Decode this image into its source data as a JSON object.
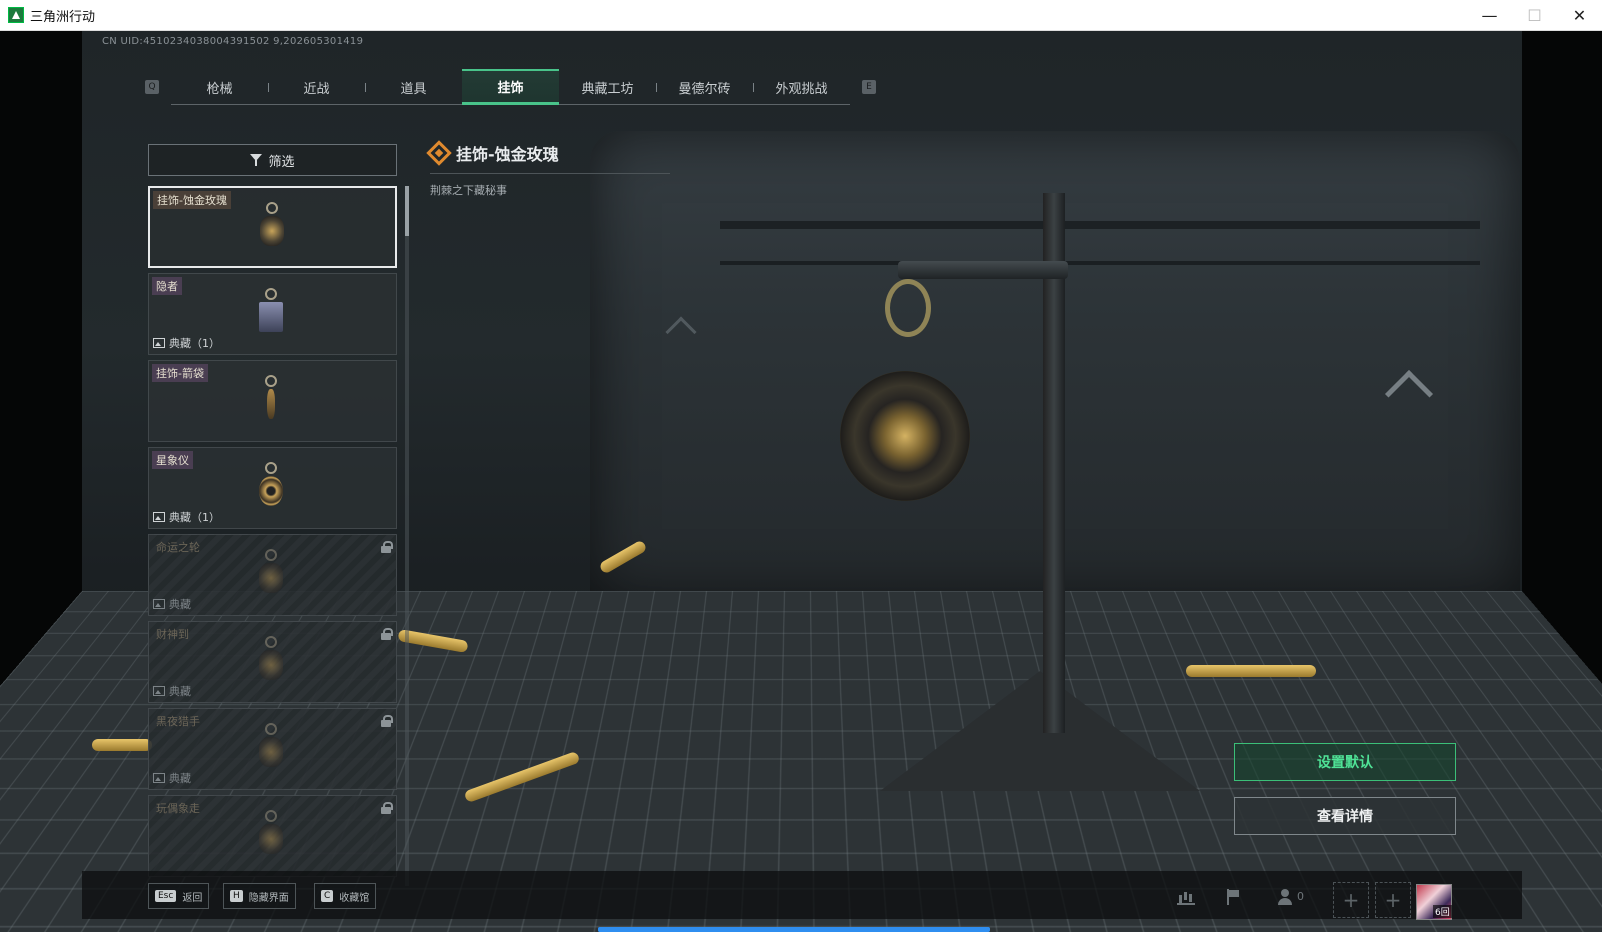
{
  "window": {
    "title": "三角洲行动",
    "minimize": "—",
    "maximize": "☐",
    "close": "✕"
  },
  "uid_text": "CN UID:4510234038004391502 9,202605301419",
  "tabs": {
    "left_key": "Q",
    "right_key": "E",
    "items": [
      {
        "label": "枪械",
        "active": false
      },
      {
        "label": "近战",
        "active": false
      },
      {
        "label": "道具",
        "active": false
      },
      {
        "label": "挂饰",
        "active": true
      },
      {
        "label": "典藏工坊",
        "active": false
      },
      {
        "label": "曼德尔砖",
        "active": false
      },
      {
        "label": "外观挑战",
        "active": false
      }
    ]
  },
  "filter": {
    "label": "筛选"
  },
  "items": [
    {
      "name": "挂饰-蚀金玫瑰",
      "tag": "",
      "locked": false,
      "selected": true
    },
    {
      "name": "隐者",
      "tag": "典藏（1）",
      "locked": false,
      "selected": false
    },
    {
      "name": "挂饰-箭袋",
      "tag": "",
      "locked": false,
      "selected": false
    },
    {
      "name": "星象仪",
      "tag": "典藏（1）",
      "locked": false,
      "selected": false
    },
    {
      "name": "命运之轮",
      "tag": "典藏",
      "locked": true,
      "selected": false
    },
    {
      "name": "财神到",
      "tag": "典藏",
      "locked": true,
      "selected": false
    },
    {
      "name": "黑夜猎手",
      "tag": "典藏",
      "locked": true,
      "selected": false
    },
    {
      "name": "玩偶象走",
      "tag": "",
      "locked": true,
      "selected": false
    }
  ],
  "detail": {
    "title": "挂饰-蚀金玫瑰",
    "description": "荆棘之下藏秘事"
  },
  "actions": {
    "set_default": "设置默认",
    "view_details": "查看详情"
  },
  "bottom": {
    "hints": [
      {
        "key": "Esc",
        "label": "返回"
      },
      {
        "key": "H",
        "label": "隐藏界面"
      },
      {
        "key": "C",
        "label": "收藏馆"
      }
    ],
    "party_count": "0",
    "slot_symbol": "+",
    "avatar_badge": "6回"
  },
  "progress": {
    "value": 1.0
  },
  "colors": {
    "accent": "#49c38a",
    "gold": "#e08a2e",
    "default_btn": "#4fe296"
  }
}
